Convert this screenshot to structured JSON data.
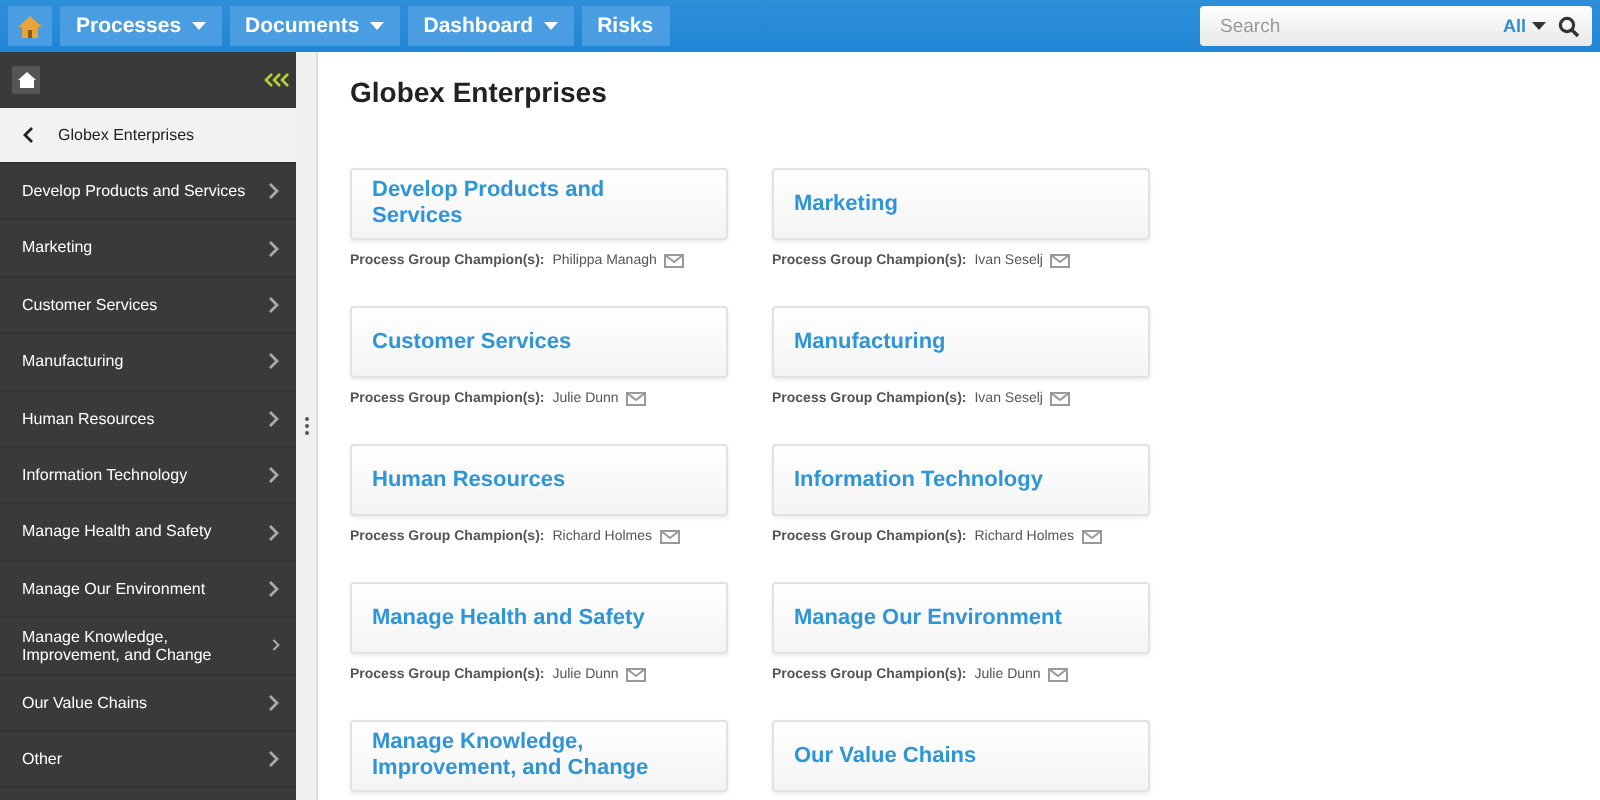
{
  "nav": {
    "tabs": [
      {
        "label": "Processes",
        "dropdown": true
      },
      {
        "label": "Documents",
        "dropdown": true
      },
      {
        "label": "Dashboard",
        "dropdown": true
      },
      {
        "label": "Risks",
        "dropdown": false
      }
    ],
    "search": {
      "placeholder": "Search",
      "scope": "All"
    }
  },
  "sidebar": {
    "items": [
      {
        "label": "Globex Enterprises",
        "selected": true,
        "kind": "back"
      },
      {
        "label": "Develop Products and Services",
        "selected": false,
        "kind": "child"
      },
      {
        "label": "Marketing",
        "selected": false,
        "kind": "child"
      },
      {
        "label": "Customer Services",
        "selected": false,
        "kind": "child"
      },
      {
        "label": "Manufacturing",
        "selected": false,
        "kind": "child"
      },
      {
        "label": "Human Resources",
        "selected": false,
        "kind": "child"
      },
      {
        "label": "Information Technology",
        "selected": false,
        "kind": "child"
      },
      {
        "label": "Manage Health and Safety",
        "selected": false,
        "kind": "child"
      },
      {
        "label": "Manage Our Environment",
        "selected": false,
        "kind": "child"
      },
      {
        "label": "Manage Knowledge, Improvement, and Change",
        "selected": false,
        "kind": "child"
      },
      {
        "label": "Our Value Chains",
        "selected": false,
        "kind": "child"
      },
      {
        "label": "Other",
        "selected": false,
        "kind": "child"
      }
    ]
  },
  "main": {
    "title": "Globex Enterprises",
    "cards": [
      {
        "title": "Develop Products and Services",
        "champion_label": "Process Group Champion(s):",
        "champion": "Philippa Managh"
      },
      {
        "title": "Marketing",
        "champion_label": "Process Group Champion(s):",
        "champion": "Ivan Seselj"
      },
      {
        "title": "Customer Services",
        "champion_label": "Process Group Champion(s):",
        "champion": "Julie Dunn"
      },
      {
        "title": "Manufacturing",
        "champion_label": "Process Group Champion(s):",
        "champion": "Ivan Seselj"
      },
      {
        "title": "Human Resources",
        "champion_label": "Process Group Champion(s):",
        "champion": "Richard Holmes"
      },
      {
        "title": "Information Technology",
        "champion_label": "Process Group Champion(s):",
        "champion": "Richard Holmes"
      },
      {
        "title": "Manage Health and Safety",
        "champion_label": "Process Group Champion(s):",
        "champion": "Julie Dunn"
      },
      {
        "title": "Manage Our Environment",
        "champion_label": "Process Group Champion(s):",
        "champion": "Julie Dunn"
      },
      {
        "title": "Manage Knowledge, Improvement, and Change"
      },
      {
        "title": "Our Value Chains"
      }
    ]
  }
}
